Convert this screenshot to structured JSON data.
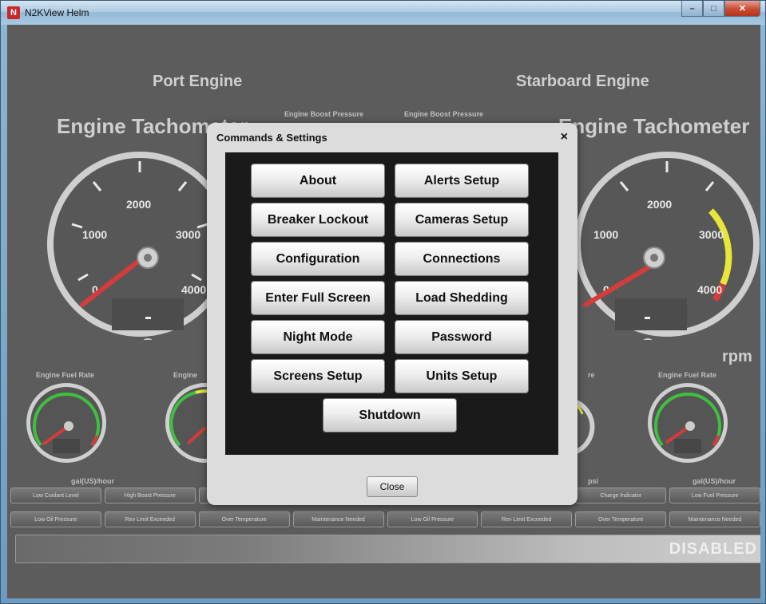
{
  "window": {
    "title": "N2KView Helm",
    "app_icon_glyph": "N",
    "controls": {
      "minimize": "–",
      "maximize": "□",
      "close": "✕"
    }
  },
  "background": {
    "port_engine": "Port Engine",
    "starboard_engine": "Starboard Engine",
    "tach_left": "Engine Tachometer",
    "tach_right": "Engine Tachometer",
    "boost_left": "Engine Boost Pressure",
    "boost_right": "Engine Boost Pressure",
    "tach_ticks": [
      "1000",
      "2000",
      "3000",
      "4000"
    ],
    "tach_zero": "0",
    "rpm_unit": "rpm",
    "fuel_rate_left": "Engine Fuel Rate",
    "fuel_rate_right": "Engine Fuel Rate",
    "engine_partial": "Engine",
    "partial_re": "re",
    "fuel_unit_left": "gal(US)/hour",
    "fuel_unit_right": "gal(US)/hour",
    "psi_unit": "psi",
    "indicator_row_1": [
      "Low Coolant Level",
      "High Boost Pressure",
      "",
      "",
      "",
      "",
      "Charge Indicator",
      "Low Fuel Pressure"
    ],
    "indicator_row_2": [
      "Low Oil Pressure",
      "Rev Limit Exceeded",
      "Over Temperature",
      "Maintenance Needed",
      "Low Oil Pressure",
      "Rev Limit Exceeded",
      "Over Temperature",
      "Maintenance Needed"
    ],
    "status": "DISABLED"
  },
  "dialog": {
    "title": "Commands & Settings",
    "close_icon": "×",
    "buttons": {
      "about": "About",
      "alerts_setup": "Alerts Setup",
      "breaker_lockout": "Breaker Lockout",
      "cameras_setup": "Cameras Setup",
      "configuration": "Configuration",
      "connections": "Connections",
      "enter_full_screen": "Enter Full Screen",
      "load_shedding": "Load Shedding",
      "night_mode": "Night Mode",
      "password": "Password",
      "screens_setup": "Screens Setup",
      "units_setup": "Units Setup",
      "shutdown": "Shutdown"
    },
    "close_label": "Close"
  }
}
